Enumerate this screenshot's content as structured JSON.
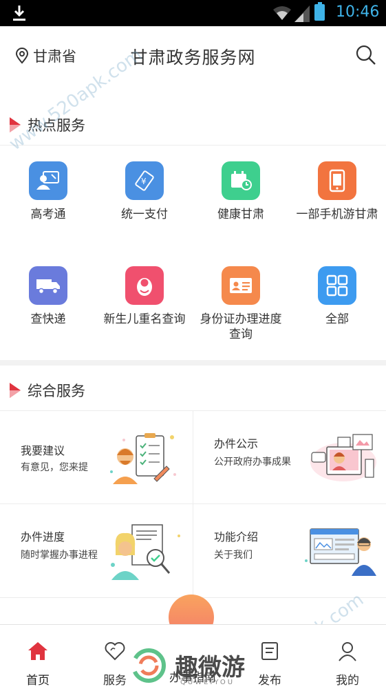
{
  "status_bar": {
    "time": "10:46"
  },
  "header": {
    "location": "甘肃省",
    "title": "甘肃政务服务网"
  },
  "hot_services": {
    "title": "热点服务",
    "items": [
      {
        "label": "高考通",
        "icon": "exam-icon",
        "color": "#4a90e2"
      },
      {
        "label": "统一支付",
        "icon": "payment-icon",
        "color": "#4a90e2"
      },
      {
        "label": "健康甘肃",
        "icon": "health-calendar-icon",
        "color": "#3ecf8e"
      },
      {
        "label": "一部手机游甘肃",
        "icon": "phone-icon",
        "color": "#f2743f"
      },
      {
        "label": "查快递",
        "icon": "delivery-truck-icon",
        "color": "#6a7bdc"
      },
      {
        "label": "新生儿重名查询",
        "icon": "baby-icon",
        "color": "#f0506e"
      },
      {
        "label": "身份证办理进度查询",
        "icon": "id-card-icon",
        "color": "#f5894c"
      },
      {
        "label": "全部",
        "icon": "grid-all-icon",
        "color": "#3d9bf0"
      }
    ]
  },
  "general_services": {
    "title": "综合服务",
    "cards": [
      {
        "title": "我要建议",
        "desc": "有意见，您来提",
        "illus": "suggestion-illustration"
      },
      {
        "title": "办件公示",
        "desc": "公开政府办事成果",
        "illus": "publicity-illustration"
      },
      {
        "title": "办件进度",
        "desc": "随时掌握办事进程",
        "illus": "progress-illustration"
      },
      {
        "title": "功能介绍",
        "desc": "关于我们",
        "illus": "about-illustration"
      }
    ]
  },
  "bottom_nav": {
    "items": [
      {
        "label": "首页",
        "icon": "home-icon",
        "active": true
      },
      {
        "label": "服务",
        "icon": "heart-icon",
        "active": false
      },
      {
        "label": "办事指南",
        "icon": "guide-icon",
        "active": false
      },
      {
        "label": "发布",
        "icon": "publish-icon",
        "active": false
      },
      {
        "label": "我的",
        "icon": "user-icon",
        "active": false
      }
    ]
  },
  "watermark": {
    "site": "www.520apk.com",
    "logo_text": "趣微游",
    "logo_sub": "QUWEIYOU"
  },
  "colors": {
    "accent_red": "#e0343f",
    "status_blue": "#3fb3e8"
  }
}
